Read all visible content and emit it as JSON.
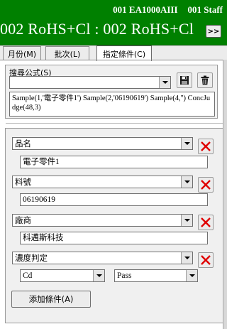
{
  "header": {
    "device": "001 EA1000AIII",
    "user": "001 Staff",
    "title": "002 RoHS+Cl : 002 RoHS+Cl",
    "next_label": ">>"
  },
  "tabs": [
    {
      "label": "月份(M)",
      "active": false
    },
    {
      "label": "批次(L)",
      "active": false
    },
    {
      "label": "指定條件(C)",
      "active": true
    }
  ],
  "formula": {
    "label": "搜尋公式(S)",
    "selected": "",
    "text": "Sample(1,'電子零件1') Sample(2,'06190619') Sample(4,'') ConcJudge(48,3)",
    "save_icon": "save-icon",
    "delete_icon": "trash-icon"
  },
  "conditions": [
    {
      "field": "品名",
      "value": "電子零件1"
    },
    {
      "field": "料號",
      "value": "06190619"
    },
    {
      "field": "廠商",
      "value": "科邁斯科技"
    },
    {
      "field": "濃度判定",
      "element": "Cd",
      "result": "Pass"
    }
  ],
  "add_condition_label": "添加條件(A)",
  "colors": {
    "header_bg": "#008000",
    "delete_x": "#e00000"
  }
}
